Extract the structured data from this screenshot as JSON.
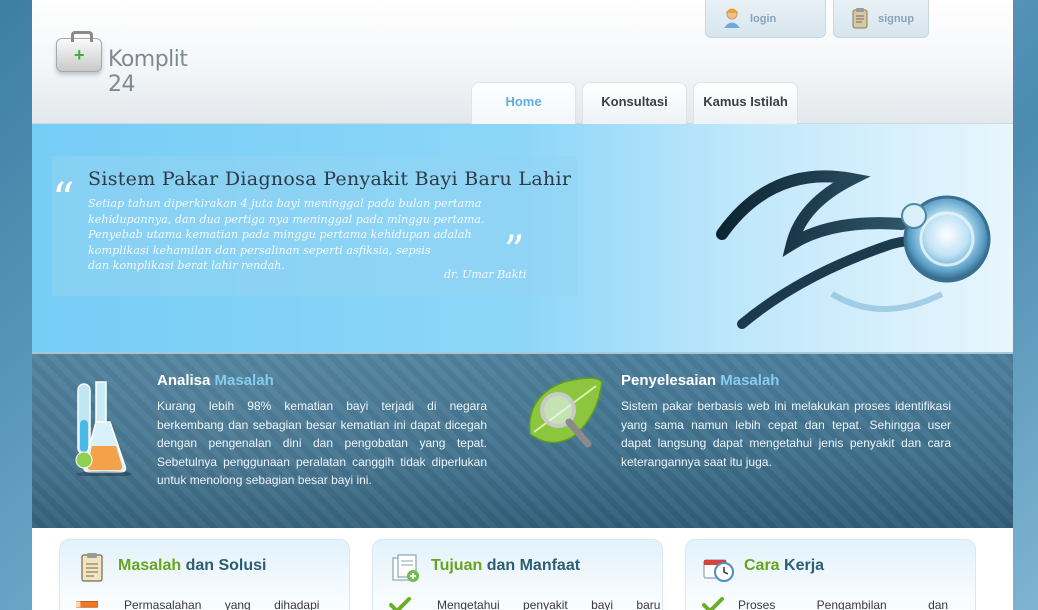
{
  "header": {
    "logo_text": "Komplit 24",
    "login_label": "login",
    "signup_label": "signup"
  },
  "nav": {
    "tabs": [
      {
        "label": "Home",
        "active": true
      },
      {
        "label": "Konsultasi",
        "active": false
      },
      {
        "label": "Kamus Istilah",
        "active": false
      }
    ]
  },
  "banner": {
    "title": "Sistem Pakar Diagnosa Penyakit Bayi Baru Lahir",
    "quote_lines": [
      "Setiap tahun diperkirakan 4 juta bayi meninggal pada bulan pertama",
      "kehidupannya, dan dua pertiga nya meninggal pada minggu pertama.",
      "Penyebab utama kematian pada minggu pertama kehidupan adalah",
      "komplikasi kehamilan dan persalinan seperti asfiksia, sepsis",
      "dan komplikasi berat lahir rendah."
    ],
    "author": "dr. Umar Bakti"
  },
  "info": {
    "left": {
      "title_a": "Analisa",
      "title_b": "Masalah",
      "text": "Kurang lebih 98% kematian bayi terjadi di negara berkembang dan sebagian besar kematian ini dapat dicegah dengan pengenalan dini dan pengobatan yang tepat. Sebetulnya penggunaan peralatan canggih tidak diperlukan untuk menolong sebagian besar bayi ini."
    },
    "right": {
      "title_a": "Penyelesaian",
      "title_b": "Masalah",
      "text": "Sistem pakar berbasis web ini melakukan proses identifikasi yang sama namun lebih cepat dan tepat. Sehingga user dapat langsung dapat mengetahui jenis penyakit dan cara keterangannya saat itu juga."
    }
  },
  "boxes": [
    {
      "title_a": "Masalah",
      "title_b": "dan Solusi",
      "item": "Permasalahan yang dihadapi"
    },
    {
      "title_a": "Tujuan",
      "title_b": "dan Manfaat",
      "item": "Mengetahui penyakit bayi baru"
    },
    {
      "title_a": "Cara",
      "title_b": "Kerja",
      "item": "Proses Pengambilan dan"
    }
  ],
  "colors": {
    "accent_blue": "#5eaee0",
    "title_green": "#67a51e",
    "title_teal": "#2d5f73",
    "band_blue": "#3f6f8b"
  }
}
